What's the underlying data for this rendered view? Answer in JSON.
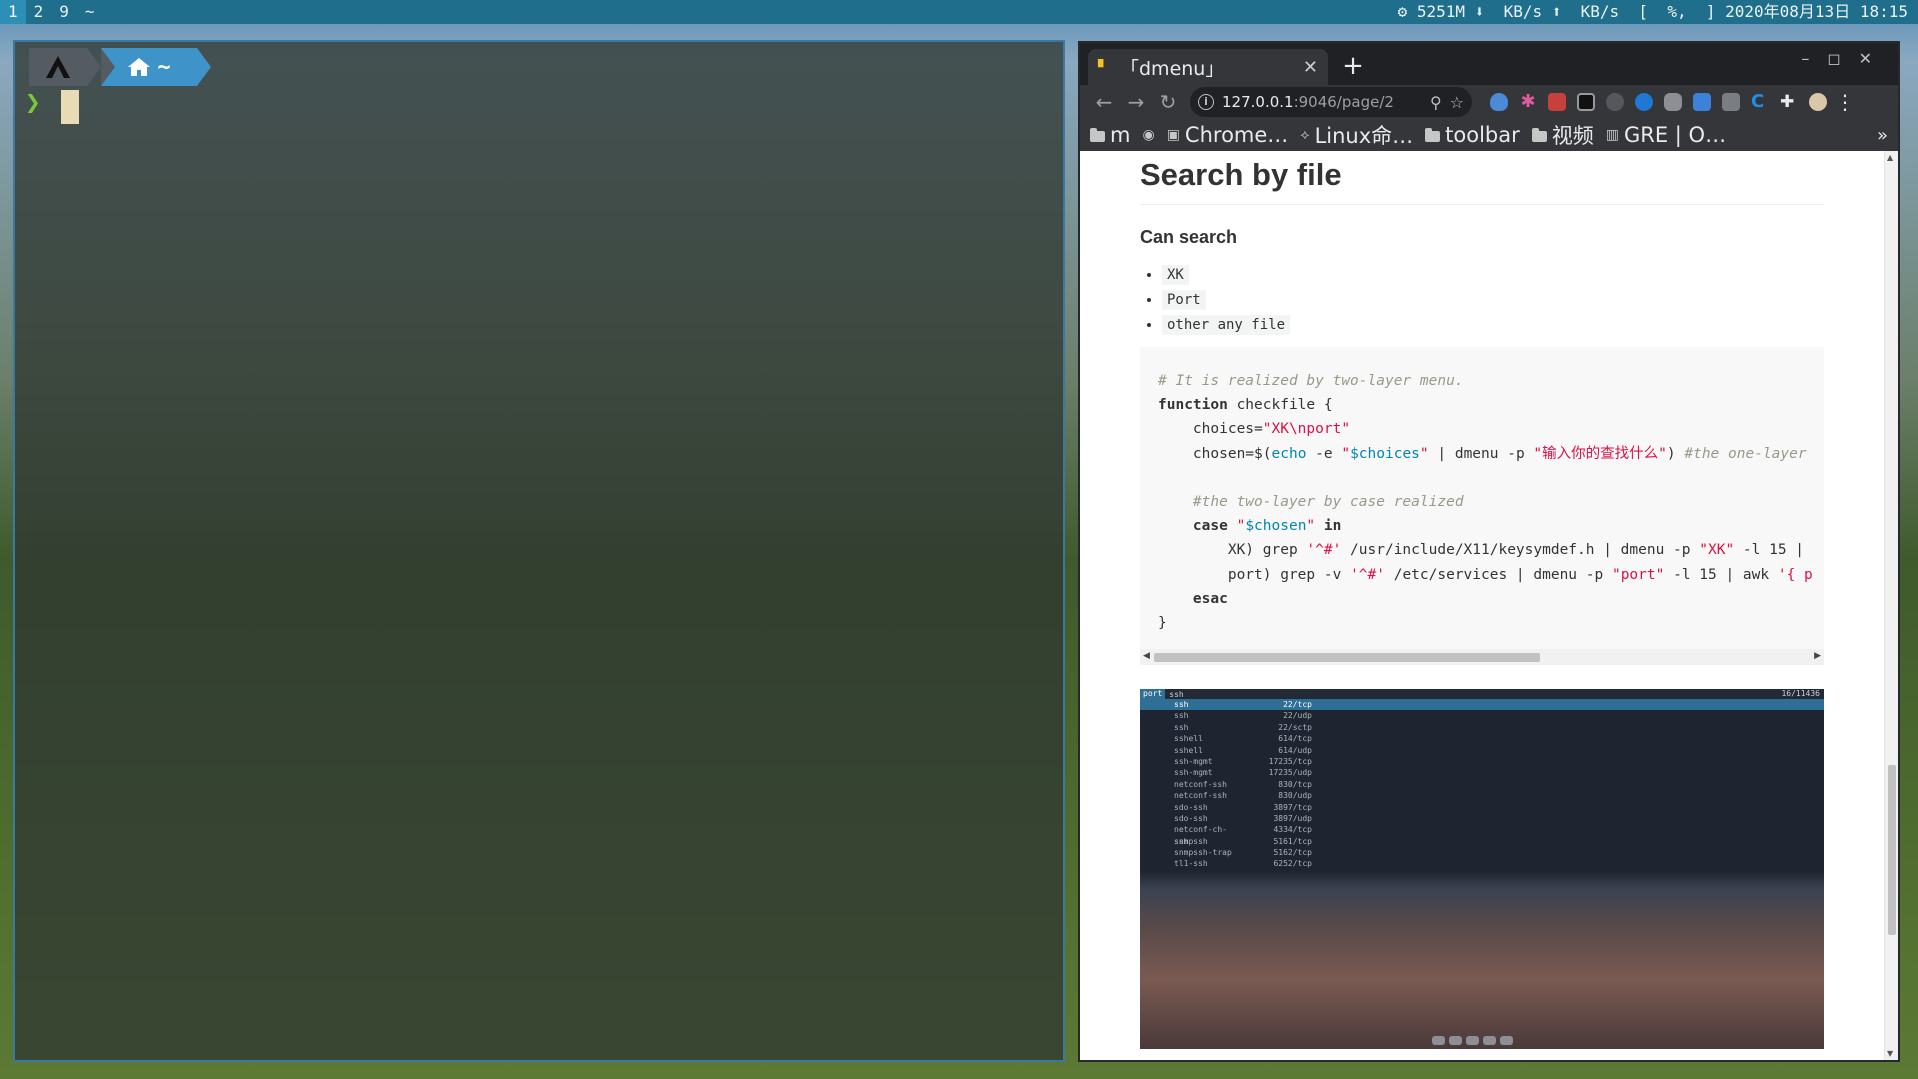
{
  "topbar": {
    "workspaces": [
      "1",
      "2",
      "9",
      "~"
    ],
    "active_workspace": "1",
    "status": "⚙ 5251M ⬇  KB/s ⬆  KB/s  [  %,  ] 2020年08月13日 18:15"
  },
  "terminal": {
    "prompt_home": "~",
    "prompt_arrow": "❯"
  },
  "browser": {
    "tab_title": "「dmenu」",
    "url_host": "127.0.0.1",
    "url_path": ":9046/page/2",
    "bookmarks": [
      {
        "icon": "folder-icon",
        "label": "m"
      },
      {
        "icon": "globe-icon",
        "label": ""
      },
      {
        "icon": "chrome-store-icon",
        "label": "Chrome…"
      },
      {
        "icon": "linux-icon",
        "label": "Linux命…"
      },
      {
        "icon": "folder-icon",
        "label": "toolbar"
      },
      {
        "icon": "folder-icon",
        "label": "视频"
      },
      {
        "icon": "book-icon",
        "label": "GRE | O…"
      }
    ],
    "bookmarks_more": "»"
  },
  "page": {
    "heading": "Search by file",
    "subheading": "Can search",
    "items": [
      "XK",
      "Port",
      "other any file"
    ]
  },
  "dmenu_screenshot": {
    "tag": "port",
    "query": "ssh",
    "count": "16/11436",
    "rows": [
      {
        "name": "ssh",
        "port": "22/tcp"
      },
      {
        "name": "ssh",
        "port": "22/udp"
      },
      {
        "name": "ssh",
        "port": "22/sctp"
      },
      {
        "name": "sshell",
        "port": "614/tcp"
      },
      {
        "name": "sshell",
        "port": "614/udp"
      },
      {
        "name": "ssh-mgmt",
        "port": "17235/tcp"
      },
      {
        "name": "ssh-mgmt",
        "port": "17235/udp"
      },
      {
        "name": "netconf-ssh",
        "port": "830/tcp"
      },
      {
        "name": "netconf-ssh",
        "port": "830/udp"
      },
      {
        "name": "sdo-ssh",
        "port": "3897/tcp"
      },
      {
        "name": "sdo-ssh",
        "port": "3897/udp"
      },
      {
        "name": "netconf-ch-ssh",
        "port": "4334/tcp"
      },
      {
        "name": "snmpssh",
        "port": "5161/tcp"
      },
      {
        "name": "snmpssh-trap",
        "port": "5162/tcp"
      },
      {
        "name": "tl1-ssh",
        "port": "6252/tcp"
      }
    ]
  },
  "colors": {
    "topbar": "#1f6e8c",
    "terminal_border": "#3b79a3",
    "prompt_home_bg": "#3e93c9",
    "prompt_arrow": "#7cc63a",
    "chrome_dark": "#35363a"
  }
}
